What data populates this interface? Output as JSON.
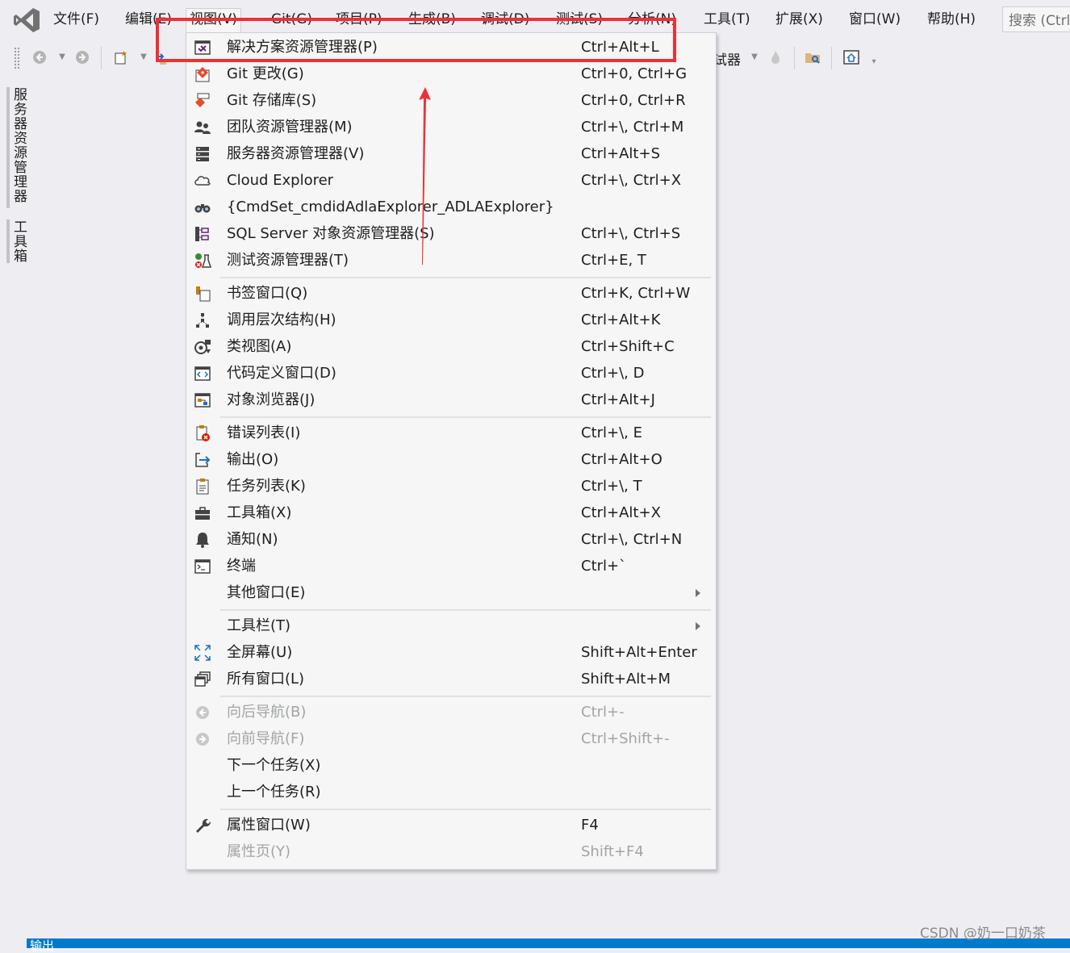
{
  "menubar": {
    "items": [
      {
        "label": "文件(F)"
      },
      {
        "label": "编辑(E)"
      },
      {
        "label": "视图(V)"
      },
      {
        "label": "Git(G)"
      },
      {
        "label": "项目(P)"
      },
      {
        "label": "生成(B)"
      },
      {
        "label": "调试(D)"
      },
      {
        "label": "测试(S)"
      },
      {
        "label": "分析(N)"
      },
      {
        "label": "工具(T)"
      },
      {
        "label": "扩展(X)"
      },
      {
        "label": "窗口(W)"
      },
      {
        "label": "帮助(H)"
      }
    ],
    "open_menu": "视图(V)",
    "search_placeholder": "搜索 (Ctrl"
  },
  "toolbar": {
    "debug_target_label": "试器"
  },
  "side_strip": {
    "tabs": [
      {
        "label": "服务器资源管理器"
      },
      {
        "label": "工具箱"
      }
    ]
  },
  "view_menu": {
    "items": [
      {
        "label": "解决方案资源管理器(P)",
        "shortcut": "Ctrl+Alt+L",
        "icon": "solution-explorer-icon"
      },
      {
        "label": "Git 更改(G)",
        "shortcut": "Ctrl+0, Ctrl+G",
        "icon": "git-changes-icon"
      },
      {
        "label": "Git 存储库(S)",
        "shortcut": "Ctrl+0, Ctrl+R",
        "icon": "git-repository-icon"
      },
      {
        "label": "团队资源管理器(M)",
        "shortcut": "Ctrl+\\, Ctrl+M",
        "icon": "team-explorer-icon"
      },
      {
        "label": "服务器资源管理器(V)",
        "shortcut": "Ctrl+Alt+S",
        "icon": "server-explorer-icon"
      },
      {
        "label": "Cloud Explorer",
        "shortcut": "Ctrl+\\, Ctrl+X",
        "icon": "cloud-icon"
      },
      {
        "label": "{CmdSet_cmdidAdlaExplorer_ADLAExplorer}",
        "shortcut": "",
        "icon": "binoculars-icon"
      },
      {
        "label": "SQL Server 对象资源管理器(S)",
        "shortcut": "Ctrl+\\, Ctrl+S",
        "icon": "sql-server-icon"
      },
      {
        "label": "测试资源管理器(T)",
        "shortcut": "Ctrl+E, T",
        "icon": "test-explorer-icon"
      },
      {
        "label": "书签窗口(Q)",
        "shortcut": "Ctrl+K, Ctrl+W",
        "icon": "bookmark-icon"
      },
      {
        "label": "调用层次结构(H)",
        "shortcut": "Ctrl+Alt+K",
        "icon": "call-hierarchy-icon"
      },
      {
        "label": "类视图(A)",
        "shortcut": "Ctrl+Shift+C",
        "icon": "class-view-icon"
      },
      {
        "label": "代码定义窗口(D)",
        "shortcut": "Ctrl+\\, D",
        "icon": "code-definition-icon"
      },
      {
        "label": "对象浏览器(J)",
        "shortcut": "Ctrl+Alt+J",
        "icon": "object-browser-icon"
      },
      {
        "label": "错误列表(I)",
        "shortcut": "Ctrl+\\, E",
        "icon": "error-list-icon"
      },
      {
        "label": "输出(O)",
        "shortcut": "Ctrl+Alt+O",
        "icon": "output-icon"
      },
      {
        "label": "任务列表(K)",
        "shortcut": "Ctrl+\\, T",
        "icon": "task-list-icon"
      },
      {
        "label": "工具箱(X)",
        "shortcut": "Ctrl+Alt+X",
        "icon": "toolbox-icon"
      },
      {
        "label": "通知(N)",
        "shortcut": "Ctrl+\\, Ctrl+N",
        "icon": "bell-icon"
      },
      {
        "label": "终端",
        "shortcut": "Ctrl+`",
        "icon": "terminal-icon"
      },
      {
        "label": "其他窗口(E)",
        "shortcut": "",
        "icon": ""
      },
      {
        "label": "工具栏(T)",
        "shortcut": "",
        "icon": ""
      },
      {
        "label": "全屏幕(U)",
        "shortcut": "Shift+Alt+Enter",
        "icon": "fullscreen-icon"
      },
      {
        "label": "所有窗口(L)",
        "shortcut": "Shift+Alt+M",
        "icon": "all-windows-icon"
      },
      {
        "label": "向后导航(B)",
        "shortcut": "Ctrl+-",
        "icon": "navigate-back-icon"
      },
      {
        "label": "向前导航(F)",
        "shortcut": "Ctrl+Shift+-",
        "icon": "navigate-forward-icon"
      },
      {
        "label": "下一个任务(X)",
        "shortcut": "",
        "icon": ""
      },
      {
        "label": "上一个任务(R)",
        "shortcut": "",
        "icon": ""
      },
      {
        "label": "属性窗口(W)",
        "shortcut": "F4",
        "icon": "wrench-icon"
      },
      {
        "label": "属性页(Y)",
        "shortcut": "Shift+F4",
        "icon": ""
      }
    ],
    "highlighted_item": "解决方案资源管理器(P)"
  },
  "bottom_panel": {
    "title": "输出"
  },
  "watermark": "CSDN @奶一口奶茶",
  "colors": {
    "annotation_red": "#ee3036",
    "accent_blue": "#007acc",
    "vs_purple": "#68217a"
  }
}
